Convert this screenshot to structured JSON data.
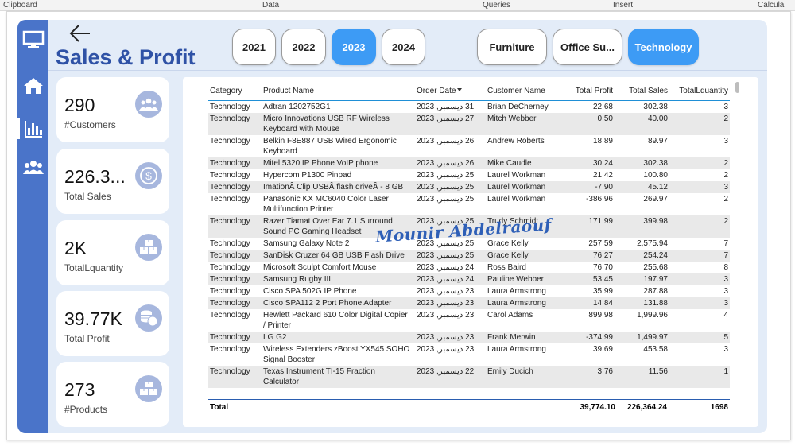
{
  "menubar": {
    "items": [
      "Clipboard",
      "Data",
      "Queries",
      "Insert",
      "Calcula"
    ]
  },
  "page": {
    "title": "Sales & Profit"
  },
  "slicers": {
    "years": [
      {
        "label": "2021",
        "selected": false
      },
      {
        "label": "2022",
        "selected": false
      },
      {
        "label": "2023",
        "selected": true
      },
      {
        "label": "2024",
        "selected": false
      }
    ],
    "categories": [
      {
        "label": "Furniture",
        "selected": false
      },
      {
        "label": "Office Su...",
        "selected": false
      },
      {
        "label": "Technology",
        "selected": true
      }
    ]
  },
  "nav": {
    "items": [
      "monitor-icon",
      "home-icon",
      "bar-chart-icon",
      "users-icon"
    ],
    "active": "bar-chart-icon"
  },
  "kpis": [
    {
      "value": "290",
      "label": "#Customers",
      "icon": "customers-icon"
    },
    {
      "value": "226.3...",
      "label": "Total Sales",
      "icon": "dollar-icon"
    },
    {
      "value": "2K",
      "label": "TotalLquantity",
      "icon": "boxes-icon"
    },
    {
      "value": "39.77K",
      "label": "Total Profit",
      "icon": "coins-icon"
    },
    {
      "value": "273",
      "label": "#Products",
      "icon": "boxes-icon"
    }
  ],
  "table": {
    "columns": [
      "Category",
      "Product Name",
      "Order Date",
      "Customer Name",
      "Total Profit",
      "Total Sales",
      "TotalLquantity"
    ],
    "rows": [
      {
        "category": "Technology",
        "product": [
          "Adtran 1202752G1"
        ],
        "date": "31 ديسمبر, 2023",
        "customer": "Brian DeCherney",
        "profit": "22.68",
        "sales": "302.38",
        "qty": "3"
      },
      {
        "category": "Technology",
        "product": [
          "Micro Innovations USB RF Wireless",
          "Keyboard with Mouse"
        ],
        "date": "27 ديسمبر, 2023",
        "customer": "Mitch Webber",
        "profit": "0.50",
        "sales": "40.00",
        "qty": "2"
      },
      {
        "category": "Technology",
        "product": [
          "Belkin F8E887 USB Wired Ergonomic",
          "Keyboard"
        ],
        "date": "26 ديسمبر, 2023",
        "customer": "Andrew Roberts",
        "profit": "18.89",
        "sales": "89.97",
        "qty": "3"
      },
      {
        "category": "Technology",
        "product": [
          "Mitel 5320 IP Phone VoIP phone"
        ],
        "date": "26 ديسمبر, 2023",
        "customer": "Mike Caudle",
        "profit": "30.24",
        "sales": "302.38",
        "qty": "2"
      },
      {
        "category": "Technology",
        "product": [
          "Hypercom P1300 Pinpad"
        ],
        "date": "25 ديسمبر, 2023",
        "customer": "Laurel Workman",
        "profit": "21.42",
        "sales": "100.80",
        "qty": "2"
      },
      {
        "category": "Technology",
        "product": [
          "ImationÂ Clip USBÂ flash driveÂ - 8 GB"
        ],
        "date": "25 ديسمبر, 2023",
        "customer": "Laurel Workman",
        "profit": "-7.90",
        "sales": "45.12",
        "qty": "3"
      },
      {
        "category": "Technology",
        "product": [
          "Panasonic KX MC6040 Color Laser",
          "Multifunction Printer"
        ],
        "date": "25 ديسمبر, 2023",
        "customer": "Laurel Workman",
        "profit": "-386.96",
        "sales": "269.97",
        "qty": "2"
      },
      {
        "category": "Technology",
        "product": [
          "Razer Tiamat Over Ear 7.1 Surround",
          "Sound PC Gaming Headset"
        ],
        "date": "25 ديسمبر, 2023",
        "customer": "Trudy Schmidt",
        "profit": "171.99",
        "sales": "399.98",
        "qty": "2"
      },
      {
        "category": "Technology",
        "product": [
          "Samsung Galaxy Note 2"
        ],
        "date": "25 ديسمبر, 2023",
        "customer": "Grace Kelly",
        "profit": "257.59",
        "sales": "2,575.94",
        "qty": "7"
      },
      {
        "category": "Technology",
        "product": [
          "SanDisk Cruzer 64 GB USB Flash Drive"
        ],
        "date": "25 ديسمبر, 2023",
        "customer": "Grace Kelly",
        "profit": "76.27",
        "sales": "254.24",
        "qty": "7"
      },
      {
        "category": "Technology",
        "product": [
          "Microsoft Sculpt Comfort Mouse"
        ],
        "date": "24 ديسمبر, 2023",
        "customer": "Ross Baird",
        "profit": "76.70",
        "sales": "255.68",
        "qty": "8"
      },
      {
        "category": "Technology",
        "product": [
          "Samsung Rugby III"
        ],
        "date": "24 ديسمبر, 2023",
        "customer": "Pauline Webber",
        "profit": "53.45",
        "sales": "197.97",
        "qty": "3"
      },
      {
        "category": "Technology",
        "product": [
          "Cisco SPA 502G IP Phone"
        ],
        "date": "23 ديسمبر, 2023",
        "customer": "Laura Armstrong",
        "profit": "35.99",
        "sales": "287.88",
        "qty": "3"
      },
      {
        "category": "Technology",
        "product": [
          "Cisco SPA112 2 Port Phone Adapter"
        ],
        "date": "23 ديسمبر, 2023",
        "customer": "Laura Armstrong",
        "profit": "14.84",
        "sales": "131.88",
        "qty": "3"
      },
      {
        "category": "Technology",
        "product": [
          "Hewlett Packard 610 Color Digital Copier",
          "/ Printer"
        ],
        "date": "23 ديسمبر, 2023",
        "customer": "Carol Adams",
        "profit": "899.98",
        "sales": "1,999.96",
        "qty": "4"
      },
      {
        "category": "Technology",
        "product": [
          "LG G2"
        ],
        "date": "23 ديسمبر, 2023",
        "customer": "Frank Merwin",
        "profit": "-374.99",
        "sales": "1,499.97",
        "qty": "5"
      },
      {
        "category": "Technology",
        "product": [
          "Wireless Extenders zBoost YX545 SOHO",
          "Signal Booster"
        ],
        "date": "23 ديسمبر, 2023",
        "customer": "Laura Armstrong",
        "profit": "39.69",
        "sales": "453.58",
        "qty": "3"
      },
      {
        "category": "Technology",
        "product": [
          "Texas Instrument TI-15 Fraction",
          "Calculator"
        ],
        "date": "22 ديسمبر, 2023",
        "customer": "Emily Ducich",
        "profit": "3.76",
        "sales": "11.56",
        "qty": "1"
      }
    ],
    "total": {
      "label": "Total",
      "profit": "39,774.10",
      "sales": "226,364.24",
      "qty": "1698"
    }
  },
  "watermark": "Mounir Abdelraouf",
  "colors": {
    "nav": "#4a74c9",
    "canvas": "#e3ecf8",
    "title": "#2f52a6",
    "accent": "#3d9bf5",
    "icon_bg": "#a7b7de"
  }
}
